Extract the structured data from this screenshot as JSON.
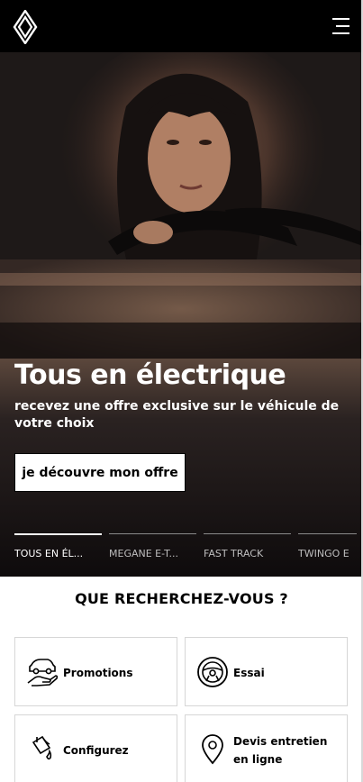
{
  "header": {
    "logo_icon": "renault-diamond-logo",
    "menu_icon": "hamburger-menu-icon"
  },
  "hero": {
    "title": "Tous en électrique",
    "subtitle": "recevez une offre exclusive sur le véhicule de votre choix",
    "cta_label": "je découvre mon offre"
  },
  "tabs": [
    {
      "label": "TOUS EN ÉL...",
      "active": true
    },
    {
      "label": "MEGANE E-T...",
      "active": false
    },
    {
      "label": "FAST TRACK",
      "active": false
    },
    {
      "label": "TWINGO E",
      "active": false
    }
  ],
  "search": {
    "title": "QUE RECHERCHEZ-VOUS ?",
    "cards": [
      {
        "label": "Promotions",
        "icon": "car-in-hand-icon"
      },
      {
        "label": "Essai",
        "icon": "steering-wheel-icon"
      },
      {
        "label": "Configurez",
        "icon": "paint-bucket-icon"
      },
      {
        "label": "Devis entretien en ligne",
        "icon": "location-pin-icon"
      }
    ]
  },
  "colors": {
    "header_bg": "#000000",
    "accent": "#ffffff"
  }
}
